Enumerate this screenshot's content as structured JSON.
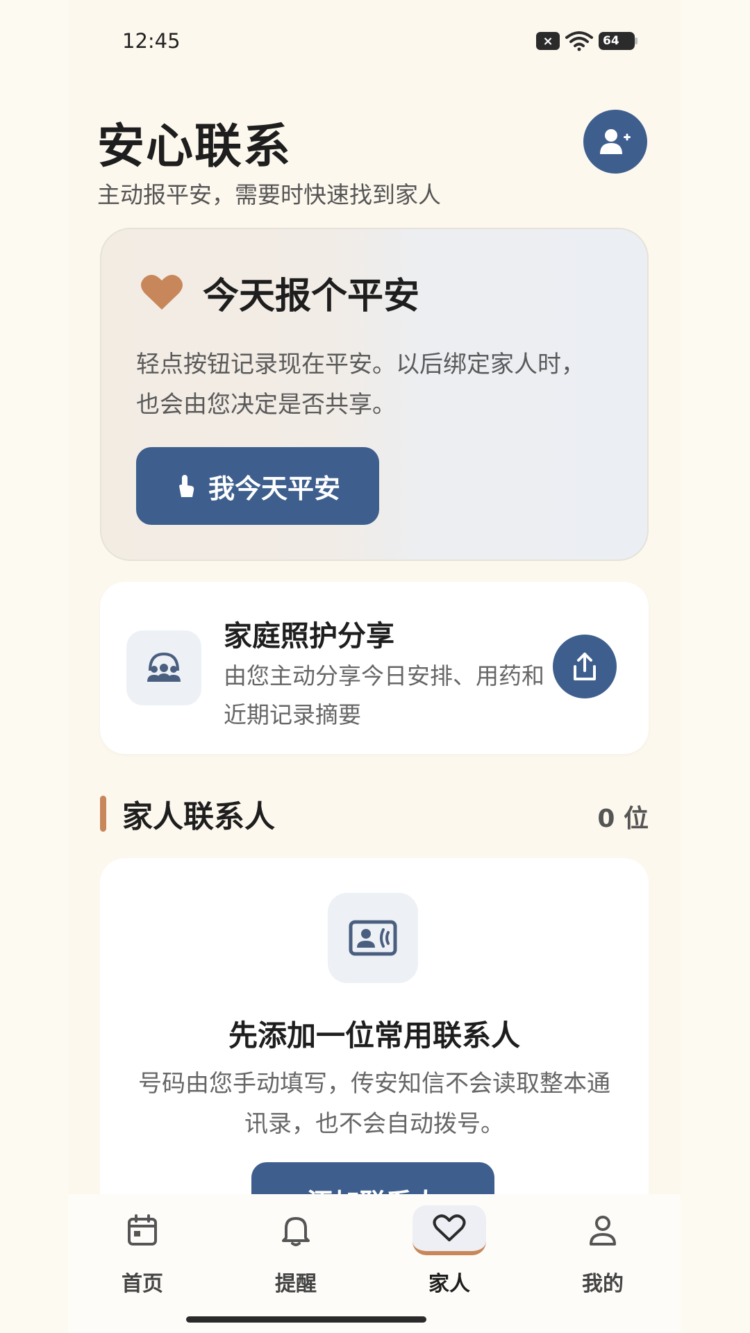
{
  "status_bar": {
    "time": "12:45",
    "battery": "64",
    "icons": [
      "sim-off-icon",
      "wifi-icon",
      "battery-icon"
    ]
  },
  "header": {
    "title": "安心联系",
    "subtitle": "主动报平安，需要时快速找到家人",
    "add_contact_icon": "person-add-icon"
  },
  "safety_card": {
    "icon": "heart-icon",
    "title": "今天报个平安",
    "description": "轻点按钮记录现在平安。以后绑定家人时，也会由您决定是否共享。",
    "button_icon": "tap-icon",
    "button_label": "我今天平安"
  },
  "share_card": {
    "icon": "family-group-icon",
    "title": "家庭照护分享",
    "description": "由您主动分享今日安排、用药和近期记录摘要",
    "button_icon": "share-icon"
  },
  "contacts_section": {
    "title": "家人联系人",
    "count": "0 位"
  },
  "empty_state": {
    "icon": "contact-card-icon",
    "title": "先添加一位常用联系人",
    "description": "号码由您手动填写，传安知信不会读取整本通讯录，也不会自动拨号。",
    "button_label": "添加联系人"
  },
  "bottom_nav": {
    "items": [
      {
        "label": "首页",
        "icon": "calendar-icon",
        "active": false
      },
      {
        "label": "提醒",
        "icon": "bell-icon",
        "active": false
      },
      {
        "label": "家人",
        "icon": "heart-outline-icon",
        "active": true
      },
      {
        "label": "我的",
        "icon": "person-icon",
        "active": false
      }
    ]
  },
  "colors": {
    "primary": "#3E5F8E",
    "accent": "#C8875A",
    "background": "#FDF8EE"
  }
}
